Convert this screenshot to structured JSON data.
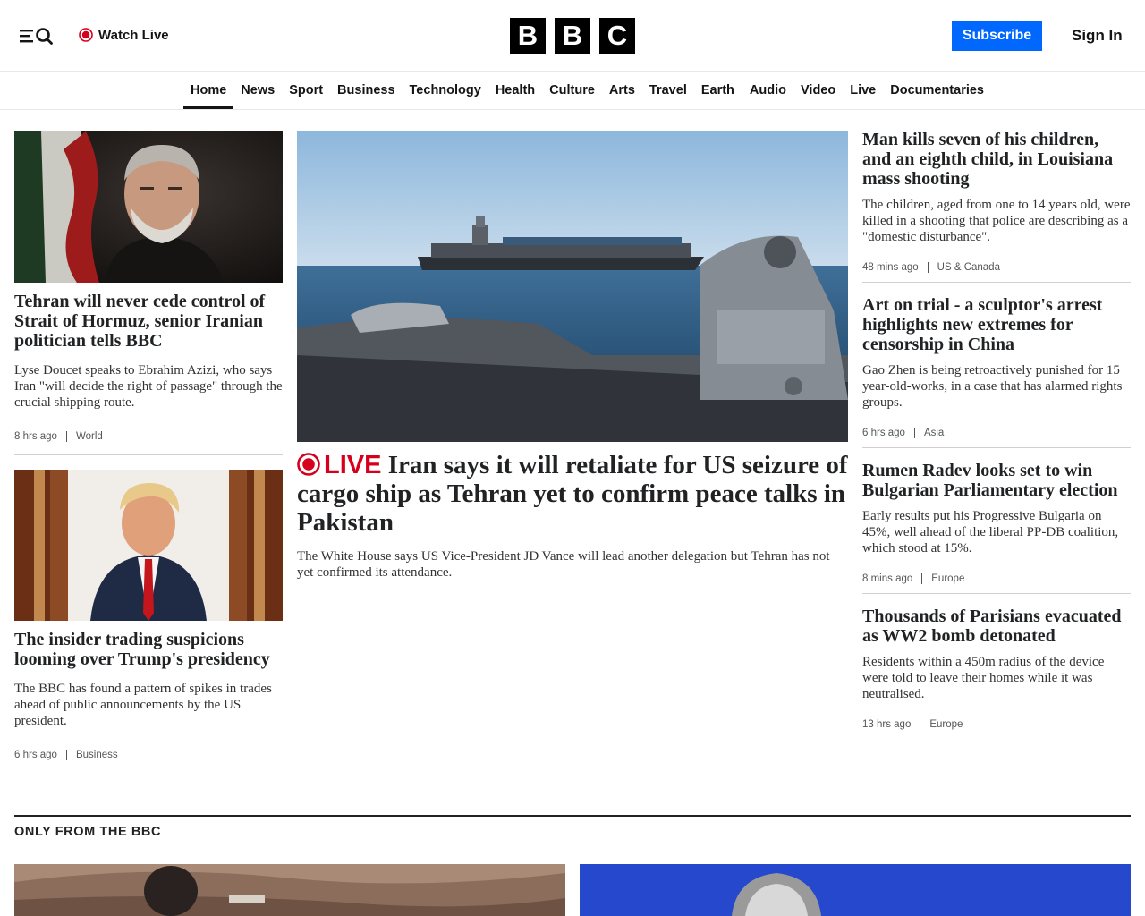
{
  "header": {
    "watch_live": "Watch Live",
    "logo_letters": [
      "B",
      "B",
      "C"
    ],
    "subscribe": "Subscribe",
    "sign_in": "Sign In"
  },
  "nav": [
    "Home",
    "News",
    "Sport",
    "Business",
    "Technology",
    "Health",
    "Culture",
    "Arts",
    "Travel",
    "Earth",
    "Audio",
    "Video",
    "Live",
    "Documentaries"
  ],
  "nav_active": "Home",
  "left_column": [
    {
      "headline": "Tehran will never cede control of Strait of Hormuz, senior Iranian politician tells BBC",
      "summary": "Lyse Doucet speaks to Ebrahim Azizi, who says Iran \"will decide the right of passage\" through the crucial shipping route.",
      "time": "8 hrs ago",
      "tag": "World"
    },
    {
      "headline": "The insider trading suspicions looming over Trump's presidency",
      "summary": "The BBC has found a pattern of spikes in trades ahead of public announcements by the US president.",
      "time": "6 hrs ago",
      "tag": "Business"
    }
  ],
  "lead_story": {
    "live_label": "LIVE",
    "headline": "Iran says it will retaliate for US seizure of cargo ship as Tehran yet to confirm peace talks in Pakistan",
    "summary": "The White House says US Vice-President JD Vance will lead another delegation but Tehran has not yet confirmed its attendance."
  },
  "right_column": [
    {
      "headline": "Man kills seven of his children, and an eighth child, in Louisiana mass shooting",
      "summary": "The children, aged from one to 14 years old, were killed in a shooting that police are describing as a \"domestic disturbance\".",
      "time": "48 mins ago",
      "tag": "US & Canada"
    },
    {
      "headline": "Art on trial - a sculptor's arrest highlights new extremes for censorship in China",
      "summary": "Gao Zhen is being retroactively punished for 15 year-old-works, in a case that has alarmed rights groups.",
      "time": "6 hrs ago",
      "tag": "Asia"
    },
    {
      "headline": "Rumen Radev looks set to win Bulgarian Parliamentary election",
      "summary": "Early results put his Progressive Bulgaria on 45%, well ahead of the liberal PP-DB coalition, which stood at 15%.",
      "time": "8 mins ago",
      "tag": "Europe"
    },
    {
      "headline": "Thousands of Parisians evacuated as WW2 bomb detonated",
      "summary": "Residents within a 450m radius of the device were told to leave their homes while it was neutralised.",
      "time": "13 hrs ago",
      "tag": "Europe"
    }
  ],
  "section": {
    "title": "ONLY FROM THE BBC"
  },
  "colors": {
    "subscribe": "#0068ff",
    "live_red": "#d6001c",
    "text": "#202224"
  }
}
